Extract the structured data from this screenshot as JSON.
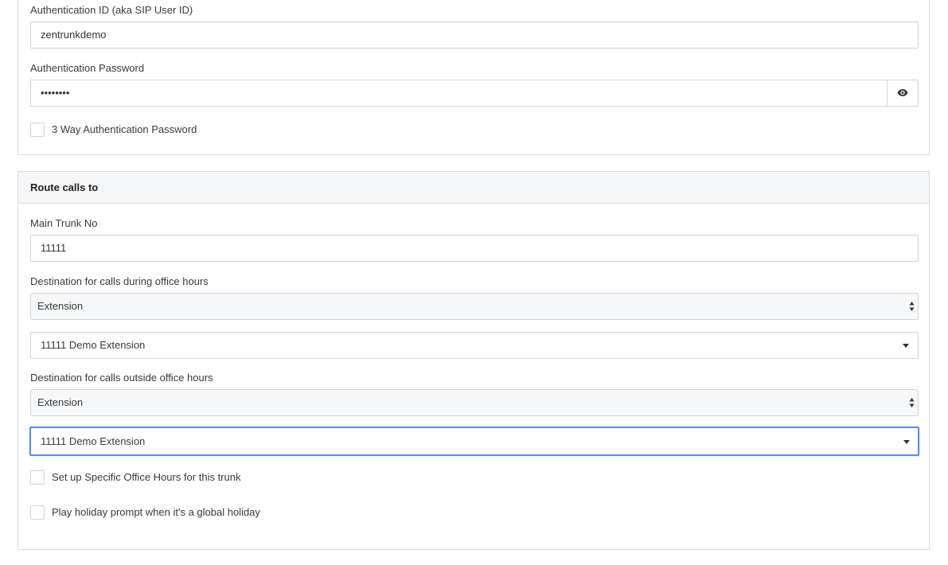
{
  "auth": {
    "id_label": "Authentication ID (aka SIP User ID)",
    "id_value": "zentrunkdemo",
    "password_label": "Authentication Password",
    "password_value": "••••••••",
    "show_password_icon": "eye-icon",
    "three_way_label": "3 Way Authentication Password",
    "three_way_checked": false
  },
  "route": {
    "heading": "Route calls to",
    "main_trunk_label": "Main Trunk No",
    "main_trunk_value": "11111",
    "office_hours_label": "Destination for calls during office hours",
    "office_hours_type": "Extension",
    "office_hours_target": "11111 Demo Extension",
    "outside_hours_label": "Destination for calls outside office hours",
    "outside_hours_type": "Extension",
    "outside_hours_target": "11111 Demo Extension",
    "specific_hours_label": "Set up Specific Office Hours for this trunk",
    "specific_hours_checked": false,
    "holiday_label": "Play holiday prompt when it's a global holiday",
    "holiday_checked": false
  },
  "colors": {
    "focus_border": "#5b8fe0",
    "panel_heading_bg": "#f5f6f7",
    "input_border": "#cfd4d9"
  }
}
